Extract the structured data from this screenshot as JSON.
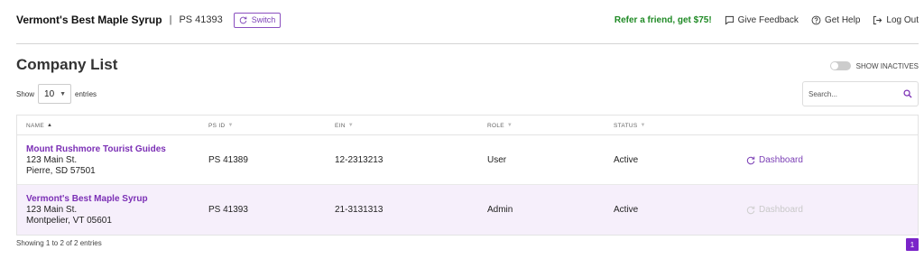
{
  "header": {
    "company_name": "Vermont's Best Maple Syrup",
    "separator": "|",
    "ps_id": "PS 41393",
    "switch_label": "Switch",
    "referral": "Refer a friend, get $75!",
    "feedback": "Give Feedback",
    "help": "Get Help",
    "logout": "Log Out"
  },
  "page": {
    "title": "Company List",
    "show_inactives": "SHOW INACTIVES",
    "show_inactives_on": false
  },
  "length": {
    "prefix": "Show",
    "value": "10",
    "suffix": "entries"
  },
  "search": {
    "placeholder": "Search..."
  },
  "table": {
    "columns": [
      "NAME",
      "PS ID",
      "EIN",
      "ROLE",
      "STATUS"
    ],
    "rows": [
      {
        "name": "Mount Rushmore Tourist Guides",
        "street": "123 Main St.",
        "city": "Pierre, SD 57501",
        "ps_id": "PS 41389",
        "ein": "12-2313213",
        "role": "User",
        "status": "Active",
        "action": "Dashboard",
        "action_enabled": true
      },
      {
        "name": "Vermont's Best Maple Syrup",
        "street": "123 Main St.",
        "city": "Montpelier, VT 05601",
        "ps_id": "PS 41393",
        "ein": "21-3131313",
        "role": "Admin",
        "status": "Active",
        "action": "Dashboard",
        "action_enabled": false
      }
    ]
  },
  "footer": {
    "info": "Showing 1 to 2 of 2 entries",
    "current_page": "1"
  },
  "colors": {
    "accent": "#7b2fb5",
    "referral": "#1f8a25",
    "highlight_row": "#f6effb",
    "pager": "#7a24c9"
  }
}
